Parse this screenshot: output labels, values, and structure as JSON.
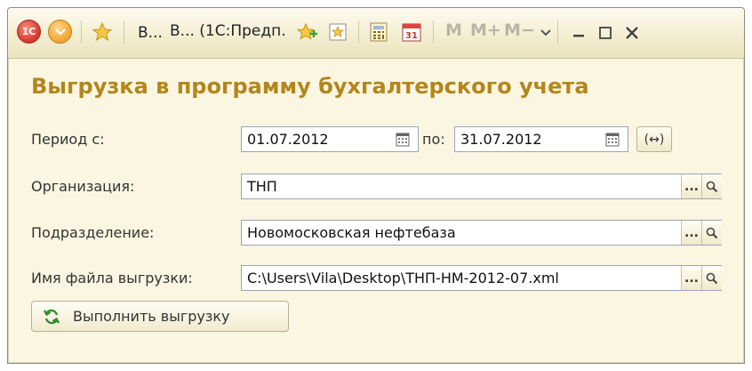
{
  "window": {
    "title": "В...  (1С:Предп.",
    "toolbar_text": {
      "m": "M",
      "m_plus": "M+",
      "m_minus": "M−"
    },
    "colors": {
      "heading": "#b3861c",
      "logo": "#d4342a",
      "background": "#fbf6e1"
    }
  },
  "form": {
    "heading": "Выгрузка в программу бухгалтерского учета",
    "period": {
      "label": "Период с:",
      "from": "01.07.2012",
      "to_label": "по:",
      "to": "31.07.2012"
    },
    "organization": {
      "label": "Организация:",
      "value": "ТНП"
    },
    "department": {
      "label": "Подразделение:",
      "value": "Новомосковская нефтебаза"
    },
    "file": {
      "label": "Имя файла выгрузки:",
      "value": "C:\\Users\\Vila\\Desktop\\ТНП-НМ-2012-07.xml"
    },
    "run_button": "Выполнить выгрузку",
    "choose_button": "...",
    "period_button": "(↔)"
  },
  "icons": [
    "1c-logo-icon",
    "menu-dropdown-icon",
    "favorite-star-icon",
    "add-favorite-icon",
    "bookmark-icon",
    "calculator-icon",
    "calendar-icon",
    "dropdown-arrow-icon",
    "minimize-icon",
    "maximize-icon",
    "close-icon",
    "calendar-picker-icon",
    "search-icon",
    "refresh-icon"
  ]
}
